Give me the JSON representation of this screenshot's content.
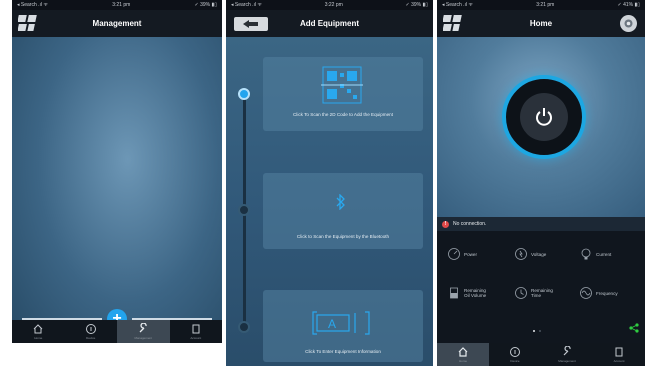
{
  "screens": [
    {
      "status": {
        "carrier": "◂ Search .ıl ᯤ",
        "time": "3:21 pm",
        "battery": "✓ 39% ▮▯"
      },
      "title": "Management",
      "tabs": [
        {
          "label": "Home",
          "icon": "home-icon"
        },
        {
          "label": "Device",
          "icon": "info-icon"
        },
        {
          "label": "Management",
          "icon": "wrench-icon",
          "active": true
        },
        {
          "label": "Account",
          "icon": "document-icon"
        }
      ]
    },
    {
      "status": {
        "carrier": "◂ Search .ıl ᯤ",
        "time": "3:22 pm",
        "battery": "✓ 39% ▮▯"
      },
      "title": "Add Equipment",
      "steps": [
        {
          "label": "Click To Scan the 2D Code to Add the Equipment",
          "icon": "qr-code-icon"
        },
        {
          "label": "Click to Scan the Equipment by the Bluetooth",
          "icon": "bluetooth-icon"
        },
        {
          "label": "Click To Enter Equipment Information",
          "icon": "text-input-icon",
          "glyph": "A"
        }
      ]
    },
    {
      "status": {
        "carrier": "◂ Search .ıl ᯤ",
        "time": "3:21 pm",
        "battery": "✓ 41% ▮▯"
      },
      "title": "Home",
      "connection": {
        "badge": "!",
        "text": "No connection."
      },
      "metrics": [
        {
          "label": "Power",
          "icon": "power-gauge-icon"
        },
        {
          "label": "Voltage",
          "icon": "voltage-icon"
        },
        {
          "label": "Current",
          "icon": "current-icon"
        },
        {
          "label": "Remaining Oil Volume",
          "icon": "oil-volume-icon"
        },
        {
          "label": "Remaining Time",
          "icon": "clock-icon"
        },
        {
          "label": "Frequency",
          "icon": "frequency-icon"
        }
      ],
      "tabs": [
        {
          "label": "Home",
          "icon": "home-icon",
          "active": true
        },
        {
          "label": "Device",
          "icon": "info-icon"
        },
        {
          "label": "Management",
          "icon": "wrench-icon"
        },
        {
          "label": "Account",
          "icon": "document-icon"
        }
      ]
    }
  ],
  "colors": {
    "accent": "#22a4ee",
    "navbar": "#141a22",
    "alert": "#e04a4a",
    "share": "#2ecc40"
  }
}
